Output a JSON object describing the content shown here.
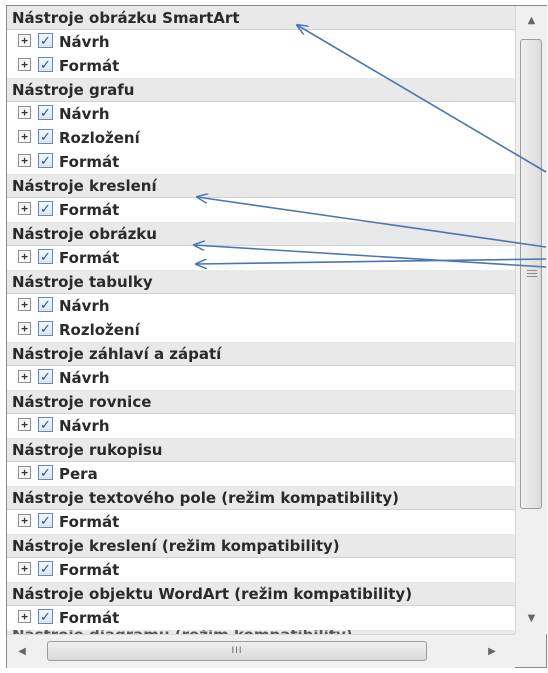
{
  "groups": [
    {
      "label": "Nástroje obrázku SmartArt",
      "items": [
        "Návrh",
        "Formát"
      ]
    },
    {
      "label": "Nástroje grafu",
      "items": [
        "Návrh",
        "Rozložení",
        "Formát"
      ]
    },
    {
      "label": "Nástroje kreslení",
      "items": [
        "Formát"
      ]
    },
    {
      "label": "Nástroje obrázku",
      "items": [
        "Formát"
      ]
    },
    {
      "label": "Nástroje tabulky",
      "items": [
        "Návrh",
        "Rozložení"
      ]
    },
    {
      "label": "Nástroje záhlaví a zápatí",
      "items": [
        "Návrh"
      ]
    },
    {
      "label": "Nástroje rovnice",
      "items": [
        "Návrh"
      ]
    },
    {
      "label": "Nástroje rukopisu",
      "items": [
        "Pera"
      ]
    },
    {
      "label": "Nástroje textového pole (režim kompatibility)",
      "items": [
        "Formát"
      ]
    },
    {
      "label": "Nástroje kreslení (režim kompatibility)",
      "items": [
        "Formát"
      ]
    },
    {
      "label": "Nástroje objektu WordArt (režim kompatibility)",
      "items": [
        "Formát"
      ]
    }
  ],
  "cut_off_row": "Nástroje diagramu (režim kompatibility)",
  "icons": {
    "expander": "plus-box-icon",
    "checkbox": "check-icon",
    "scroll_up": "triangle-up-icon",
    "scroll_down": "triangle-down-icon",
    "scroll_left": "triangle-left-icon",
    "scroll_right": "triangle-right-icon",
    "grip": "grip-icon"
  },
  "colors": {
    "annotation_arrow": "#4a76b2",
    "group_header_bg": "#e9e9e9",
    "checkbox_check": "#2c4f8c"
  }
}
